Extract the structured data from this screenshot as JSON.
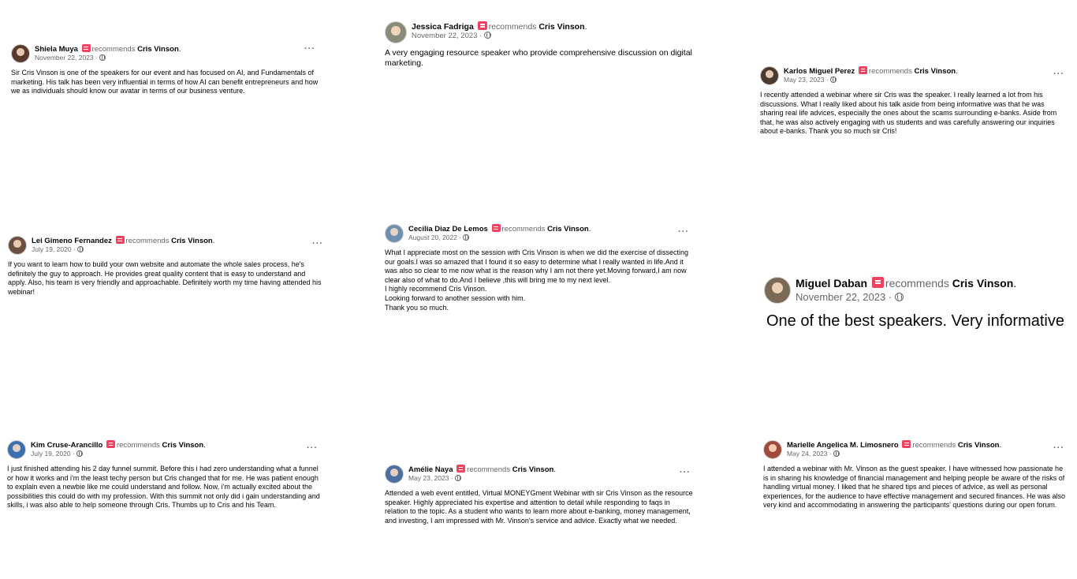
{
  "common": {
    "recommends": "recommends",
    "target": "Cris Vinson",
    "period": ".",
    "dot": " · ",
    "more": "···"
  },
  "reviews": [
    {
      "name": "Shiela Muya",
      "date": "November 22, 2023",
      "avatar_color": "#5a3a2e",
      "text": "Sir Cris Vinson is one of the speakers for our event and has focused on AI, and Fundamentals of marketing. His talk has been very influential in terms of how AI can benefit entrepreneurs and how we as individuals should know our avatar in terms of our business venture."
    },
    {
      "name": "Jessica Fadriga",
      "date": "November 22, 2023",
      "avatar_color": "#8a8a7a",
      "text": "A very engaging resource speaker who provide comprehensive discussion on digital marketing."
    },
    {
      "name": "Karlos Miguel Perez",
      "date": "May 23, 2023",
      "avatar_color": "#4a3a30",
      "text": "I recently attended a webinar where sir Cris was the speaker. I really learned a lot from his discussions. What I really liked about his talk aside from being informative was that he was sharing real life advices, especially the ones about the scams surrounding e-banks. Aside from that, he was also actively engaging with us students and was carefully answering our inquiries about e-banks. Thank you so much sir Cris!"
    },
    {
      "name": "Lei Gimeno Fernandez",
      "date": "July 19, 2020",
      "avatar_color": "#6b5040",
      "text": "If you want to learn how to build your own website and automate the whole sales process, he's definitely the guy to approach. He provides great quality content that is easy to understand and apply. Also, his team is very friendly and approachable. Definitely worth my time having attended his webinar!"
    },
    {
      "name": "Cecilia Diaz De Lemos",
      "date": "August 20, 2022",
      "avatar_color": "#6f8fb0",
      "text": "What I appreciate most on the session with Cris Vinson is when we did the exercise of dissecting our goals.I was so amazed  that I found it so easy to determine what I really wanted in life.And  it was also so clear to me now what is the reason why I am not there yet.Moving forward,I am now clear also of what to do.And I believe ,this will bring me to my next level.\nI highly recommend Cris Vinson.\nLooking forward to another session with him.\nThank you so much."
    },
    {
      "name": "Miguel Daban",
      "date": "November 22, 2023",
      "avatar_color": "#7a6a55",
      "text": "One of the best speakers. Very informative"
    },
    {
      "name": "Kim Cruse-Arancillo",
      "date": "July 19, 2020",
      "avatar_color": "#3a6fb0",
      "text": "I just finished attending his 2 day funnel summit. Before this i had zero understanding what a funnel or how it works and i'm the least techy person but Cris changed that for me. He was patient enough to explain  even a newbie like me could understand and follow. Now, i'm actually excited about the possibilities this could do with my profession. With this summit not only did i gain understanding and skills, i was also able to help someone through Cris. Thumbs up to Cris and his Team."
    },
    {
      "name": "Amélie Naya",
      "date": "May 23, 2023",
      "avatar_color": "#4a6fa0",
      "text": "Attended a web event entitled, Virtual MONEYGment Webinar with sir Cris Vinson as the resource speaker. Highly appreciated his expertise and attention to detail while responding to faqs in relation to the topic. As a student who wants to learn more about e-banking, money management, and investing, I am impressed with Mr. Vinson's service and advice. Exactly what we needed."
    },
    {
      "name": "Marielle Angelica M. Limosnero",
      "date": "May 24, 2023",
      "avatar_color": "#a04a3a",
      "text": "I attended a webinar with Mr. Vinson as the guest speaker. I have witnessed how passionate he is in sharing his knowledge of financial management and helping people be aware of the risks of handling virtual money. I liked that he shared tips and pieces of advice, as well as personal experiences, for the audience to have effective management and secured finances. He was also very kind and accommodating in answering the participants' questions during our open forum."
    }
  ]
}
